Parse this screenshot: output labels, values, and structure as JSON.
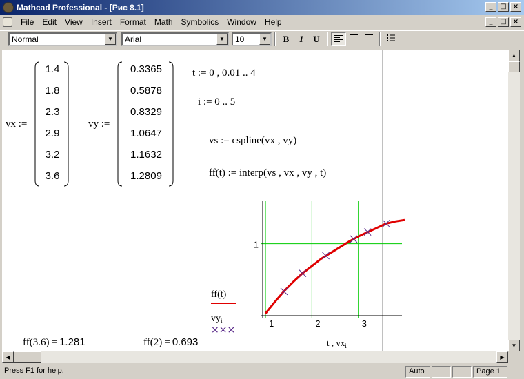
{
  "window": {
    "title": "Mathcad Professional - [Рис 8.1]",
    "controls": {
      "minimize": "_",
      "maximize": "□",
      "close": "×"
    }
  },
  "menu": [
    "File",
    "Edit",
    "View",
    "Insert",
    "Format",
    "Math",
    "Symbolics",
    "Window",
    "Help"
  ],
  "toolbar": {
    "style": "Normal",
    "font": "Arial",
    "size": "10",
    "bold": "B",
    "italic": "I",
    "underline": "U"
  },
  "worksheet": {
    "vx_label": "vx :=",
    "vx_values": [
      "1.4",
      "1.8",
      "2.3",
      "2.9",
      "3.2",
      "3.6"
    ],
    "vy_label": "vy :=",
    "vy_values": [
      "0.3365",
      "0.5878",
      "0.8329",
      "1.0647",
      "1.1632",
      "1.2809"
    ],
    "t_def": "t := 0 , 0.01 .. 4",
    "i_def": "i := 0 .. 5",
    "vs_def": "vs := cspline(vx , vy)",
    "ff_def": "ff(t) := interp(vs , vx , vy , t)",
    "eval1_expr": "ff(3.6)",
    "eval1_eq": "=",
    "eval1_val": "1.281",
    "eval2_expr": "ff(2)",
    "eval2_eq": "=",
    "eval2_val": "0.693"
  },
  "chart_data": {
    "type": "line",
    "series": [
      {
        "name": "ff(t)",
        "style": "line",
        "color": "#e00000",
        "x": [
          1.0,
          1.2,
          1.4,
          1.6,
          1.8,
          2.0,
          2.2,
          2.4,
          2.6,
          2.8,
          3.0,
          3.2,
          3.4,
          3.6,
          3.8,
          4.0
        ],
        "y": [
          0.03,
          0.19,
          0.34,
          0.47,
          0.59,
          0.69,
          0.79,
          0.87,
          0.95,
          1.03,
          1.1,
          1.16,
          1.22,
          1.28,
          1.31,
          1.33
        ]
      },
      {
        "name": "vyi",
        "style": "markers",
        "color": "#5a2a8a",
        "x": [
          1.4,
          1.8,
          2.3,
          2.9,
          3.2,
          3.6
        ],
        "y": [
          0.3365,
          0.5878,
          0.8329,
          1.0647,
          1.1632,
          1.2809
        ]
      }
    ],
    "xlabel": "t , vxi",
    "xticks": [
      "1",
      "2",
      "3"
    ],
    "yticks": [
      "1"
    ],
    "xlim": [
      0.94,
      3.94
    ],
    "ylim": [
      0,
      1.6
    ],
    "grid": true,
    "grid_color": "#00cc00",
    "legend": [
      {
        "label": "ff(t)",
        "sample": "line"
      },
      {
        "label": "vyi",
        "sample": "×××"
      }
    ]
  },
  "status": {
    "help": "Press F1 for help.",
    "mode": "Auto",
    "page": "Page 1"
  }
}
